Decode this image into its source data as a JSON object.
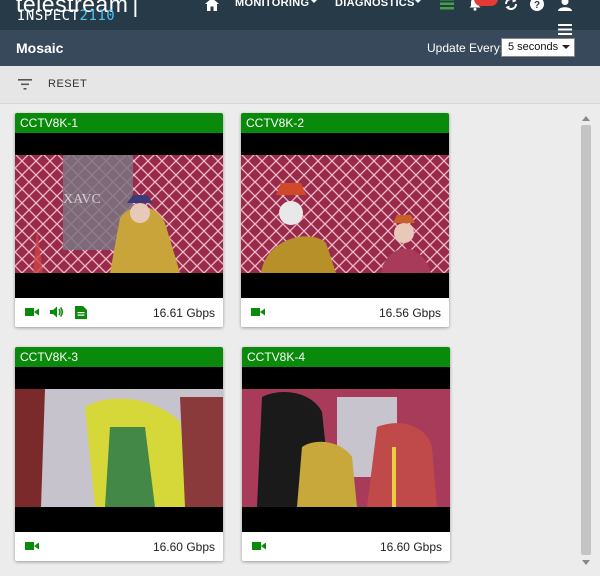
{
  "app": {
    "brand": "telestream",
    "product_prefix": "INSPECT",
    "product_suffix": "2110"
  },
  "nav": {
    "monitoring_label": "MONITORING",
    "diagnostics_label": "DIAGNOSTICS"
  },
  "subheader": {
    "title": "Mosaic",
    "update_label": "Update Every:",
    "update_value": "5 seconds"
  },
  "toolbar": {
    "reset_label": "RESET"
  },
  "colors": {
    "topbar": "#263a48",
    "subheader": "#37495a",
    "card_header": "#0a8a0a",
    "icon_green": "#0a8a0a",
    "product_accent": "#4fc3f7",
    "badge": "#e53935"
  },
  "tiles": [
    {
      "name": "CCTV8K-1",
      "bitrate": "16.61 Gbps",
      "icons": [
        "video-icon",
        "audio-icon",
        "data-icon"
      ],
      "overlay": "XAVC"
    },
    {
      "name": "CCTV8K-2",
      "bitrate": "16.56 Gbps",
      "icons": [
        "video-icon"
      ],
      "overlay": ""
    },
    {
      "name": "CCTV8K-3",
      "bitrate": "16.60 Gbps",
      "icons": [
        "video-icon"
      ],
      "overlay": ""
    },
    {
      "name": "CCTV8K-4",
      "bitrate": "16.60 Gbps",
      "icons": [
        "video-icon"
      ],
      "overlay": ""
    }
  ]
}
